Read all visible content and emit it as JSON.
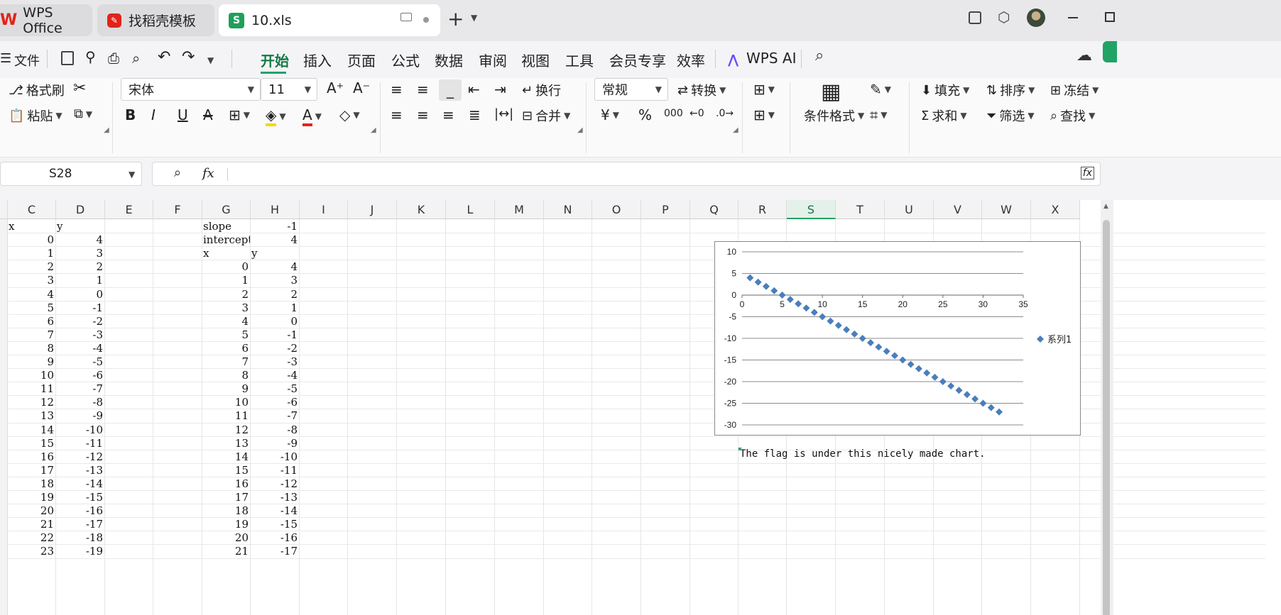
{
  "tabs": {
    "app_label": "WPS Office",
    "template_label": "找稻壳模板",
    "file_label": "10.xls"
  },
  "menu": {
    "file": "文件",
    "items": [
      "开始",
      "插入",
      "页面",
      "公式",
      "数据",
      "审阅",
      "视图",
      "工具",
      "会员专享",
      "效率"
    ],
    "ai": "WPS AI"
  },
  "ribbon": {
    "format_painter": "格式刷",
    "paste": "粘贴",
    "font_name": "宋体",
    "font_size": "11",
    "wrap": "换行",
    "merge": "合并",
    "number_format": "常规",
    "convert": "转换",
    "conditional": "条件格式",
    "fill": "填充",
    "sort": "排序",
    "freeze": "冻结",
    "sum": "求和",
    "filter": "筛选",
    "find": "查找",
    "currency": "¥",
    "percent": "%",
    "thousands": "000"
  },
  "formula_bar": {
    "cell_ref": "S28",
    "fx": "fx",
    "value": ""
  },
  "sheet": {
    "columns": [
      "C",
      "D",
      "E",
      "F",
      "G",
      "H",
      "I",
      "J",
      "K",
      "L",
      "M",
      "N",
      "O",
      "P",
      "Q",
      "R",
      "S",
      "T",
      "U",
      "V",
      "W",
      "X"
    ],
    "selected_column": "S",
    "c_col": [
      "x",
      "0",
      "1",
      "2",
      "3",
      "4",
      "5",
      "6",
      "7",
      "8",
      "9",
      "10",
      "11",
      "12",
      "13",
      "14",
      "15",
      "16",
      "17",
      "18",
      "19",
      "20",
      "21",
      "22",
      "23"
    ],
    "d_col": [
      "y",
      "4",
      "3",
      "2",
      "1",
      "0",
      "-1",
      "-2",
      "-3",
      "-4",
      "-5",
      "-6",
      "-7",
      "-8",
      "-9",
      "-10",
      "-11",
      "-12",
      "-13",
      "-14",
      "-15",
      "-16",
      "-17",
      "-18",
      "-19"
    ],
    "g_col": [
      "slope",
      "intercept",
      "x",
      "0",
      "1",
      "2",
      "3",
      "4",
      "5",
      "6",
      "7",
      "8",
      "9",
      "10",
      "11",
      "12",
      "13",
      "14",
      "15",
      "16",
      "17",
      "18",
      "19",
      "20",
      "21"
    ],
    "h_col": [
      "-1",
      "4",
      "y",
      "4",
      "3",
      "2",
      "1",
      "0",
      "-1",
      "-2",
      "-3",
      "-4",
      "-5",
      "-6",
      "-7",
      "-8",
      "-9",
      "-10",
      "-11",
      "-12",
      "-13",
      "-14",
      "-15",
      "-16",
      "-17"
    ],
    "note": "The flag is under this nicely made chart."
  },
  "chart_data": {
    "type": "scatter",
    "series": [
      {
        "name": "系列1",
        "x": [
          1,
          2,
          3,
          4,
          5,
          6,
          7,
          8,
          9,
          10,
          11,
          12,
          13,
          14,
          15,
          16,
          17,
          18,
          19,
          20,
          21,
          22,
          23,
          24,
          25,
          26,
          27,
          28,
          29,
          30,
          31,
          32
        ],
        "y": [
          4,
          3,
          2,
          1,
          0,
          -1,
          -2,
          -3,
          -4,
          -5,
          -6,
          -7,
          -8,
          -9,
          -10,
          -11,
          -12,
          -13,
          -14,
          -15,
          -16,
          -17,
          -18,
          -19,
          -20,
          -21,
          -22,
          -23,
          -24,
          -25,
          -26,
          -27
        ],
        "color": "#4a7ebb"
      }
    ],
    "xlim": [
      0,
      35
    ],
    "ylim": [
      -30,
      10
    ],
    "x_ticks": [
      "0",
      "5",
      "10",
      "15",
      "20",
      "25",
      "30",
      "35"
    ],
    "y_ticks": [
      "10",
      "5",
      "0",
      "-5",
      "-10",
      "-15",
      "-20",
      "-25",
      "-30"
    ],
    "legend_position": "right",
    "grid": true
  },
  "colors": {
    "accent_green": "#21a366",
    "wps_red": "#e2231a",
    "series_blue": "#4a7ebb"
  }
}
